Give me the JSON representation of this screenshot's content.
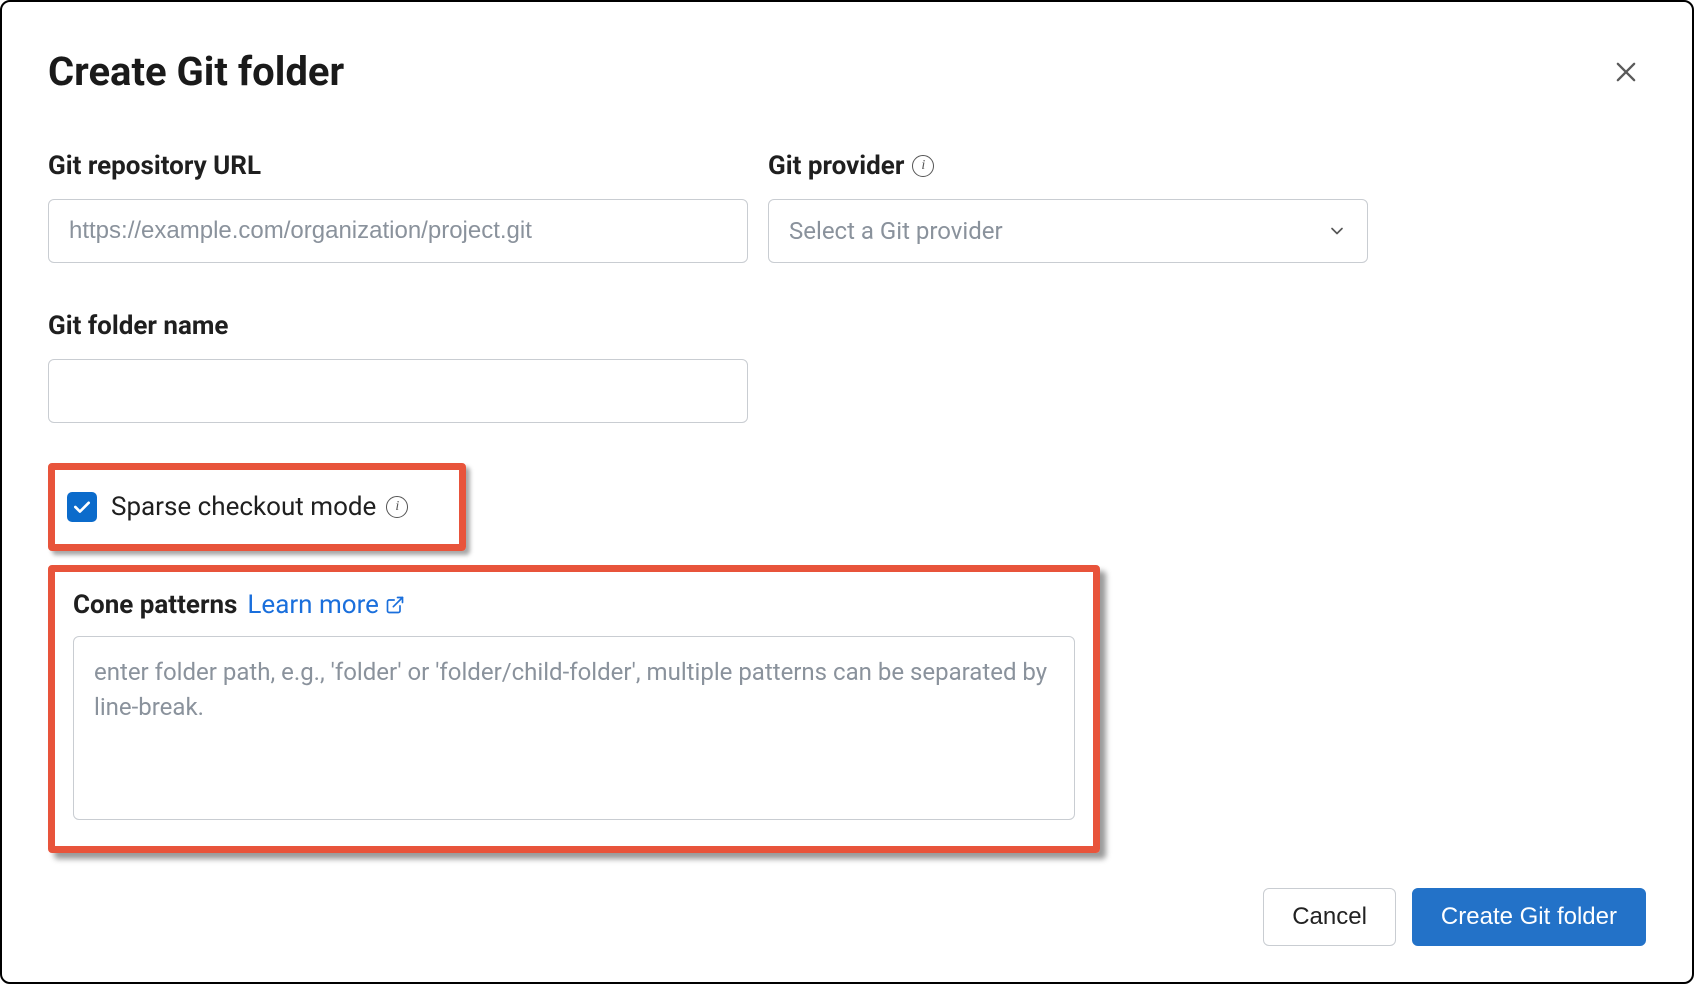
{
  "dialog": {
    "title": "Create Git folder"
  },
  "repo": {
    "label": "Git repository URL",
    "placeholder": "https://example.com/organization/project.git",
    "value": ""
  },
  "provider": {
    "label": "Git provider",
    "placeholder": "Select a Git provider",
    "selected": ""
  },
  "folder": {
    "label": "Git folder name",
    "value": ""
  },
  "sparse": {
    "label": "Sparse checkout mode",
    "checked": true
  },
  "cone": {
    "label": "Cone patterns",
    "learn_more": "Learn more",
    "placeholder": "enter folder path, e.g., 'folder' or 'folder/child-folder', multiple patterns can be separated by line-break.",
    "value": ""
  },
  "actions": {
    "cancel": "Cancel",
    "submit": "Create Git folder"
  }
}
